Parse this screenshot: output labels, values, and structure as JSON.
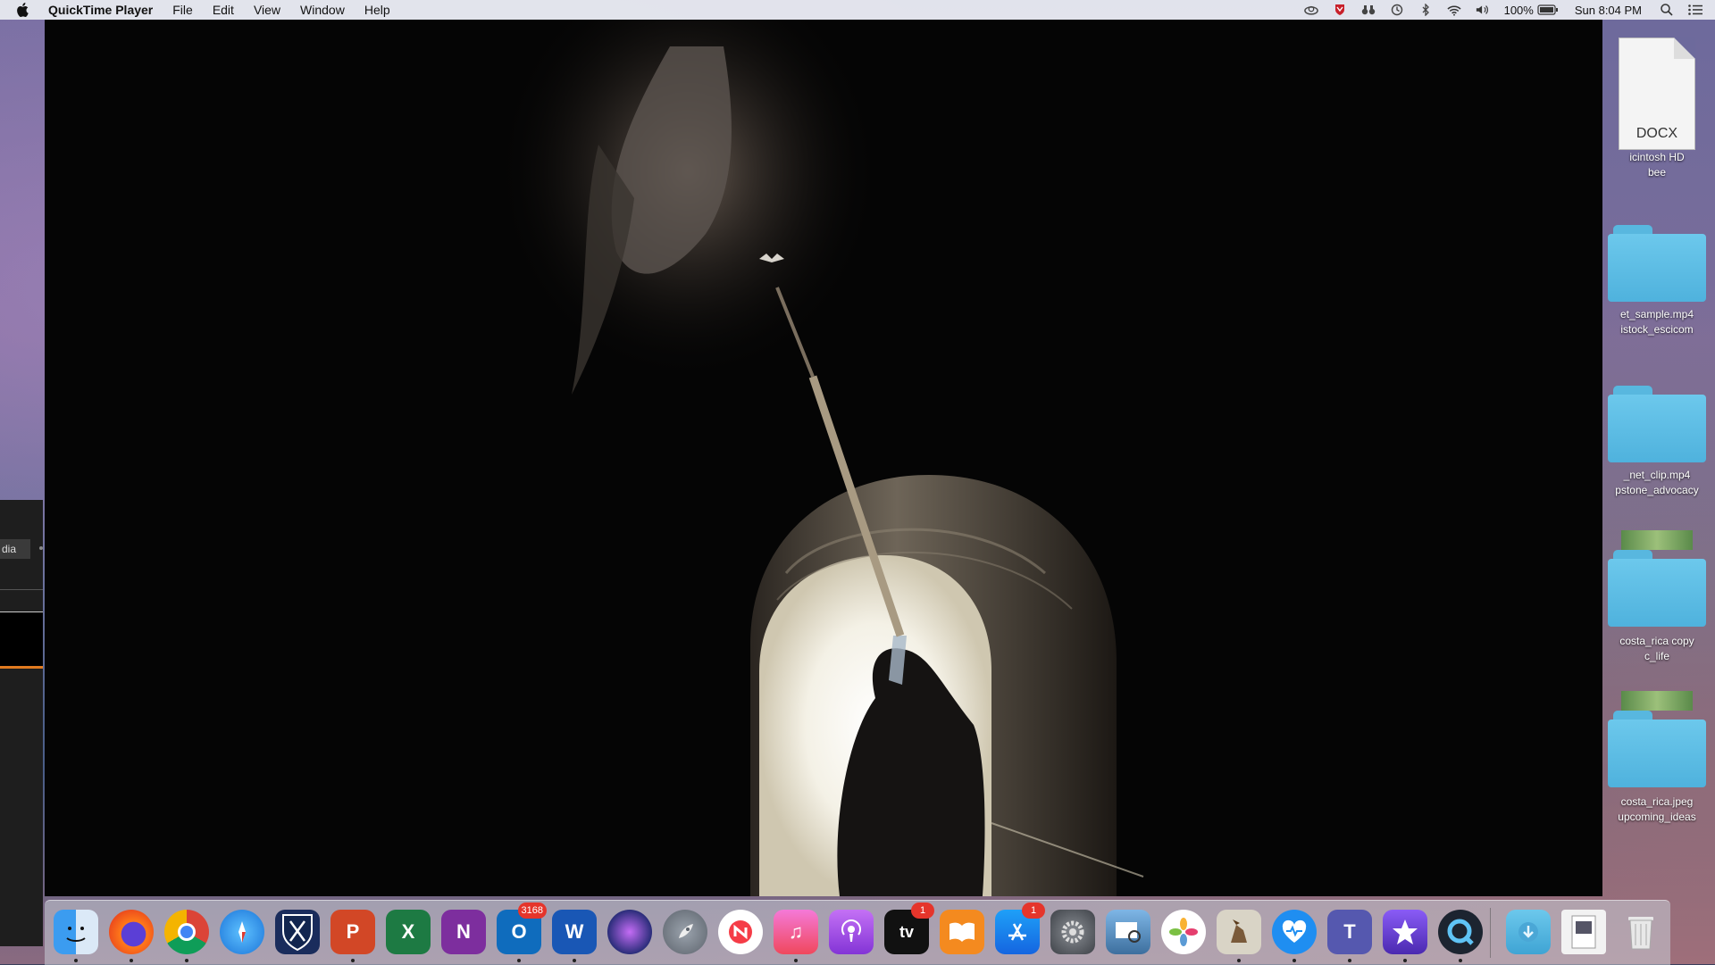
{
  "menubar": {
    "app_name": "QuickTime Player",
    "menus": [
      "File",
      "Edit",
      "View",
      "Window",
      "Help"
    ],
    "battery": "100%",
    "clock": "Sun 8:04 PM"
  },
  "left_window": {
    "tab_label": "dia"
  },
  "desktop_items": [
    {
      "kind": "DOCX",
      "label1": "icintosh HD",
      "label2": "bee"
    },
    {
      "label1": "et_sample.mp4",
      "label2": "istock_escicom"
    },
    {
      "label1": "_net_clip.mp4",
      "label2": "pstone_advocacy"
    },
    {
      "label1": "costa_rica copy",
      "label2": "c_life"
    },
    {
      "label1": "costa_rica.jpeg",
      "label2": "upcoming_ideas"
    }
  ],
  "dock": {
    "outlook_badge": "3168",
    "tv_badge": "1",
    "appstore_badge": "1",
    "tv_label": "tv"
  },
  "colors": {
    "menubar_bg": "#e8eaf0",
    "video_bg": "#050505",
    "folder_blue": "#58b7df",
    "badge_red": "#e5352b"
  }
}
